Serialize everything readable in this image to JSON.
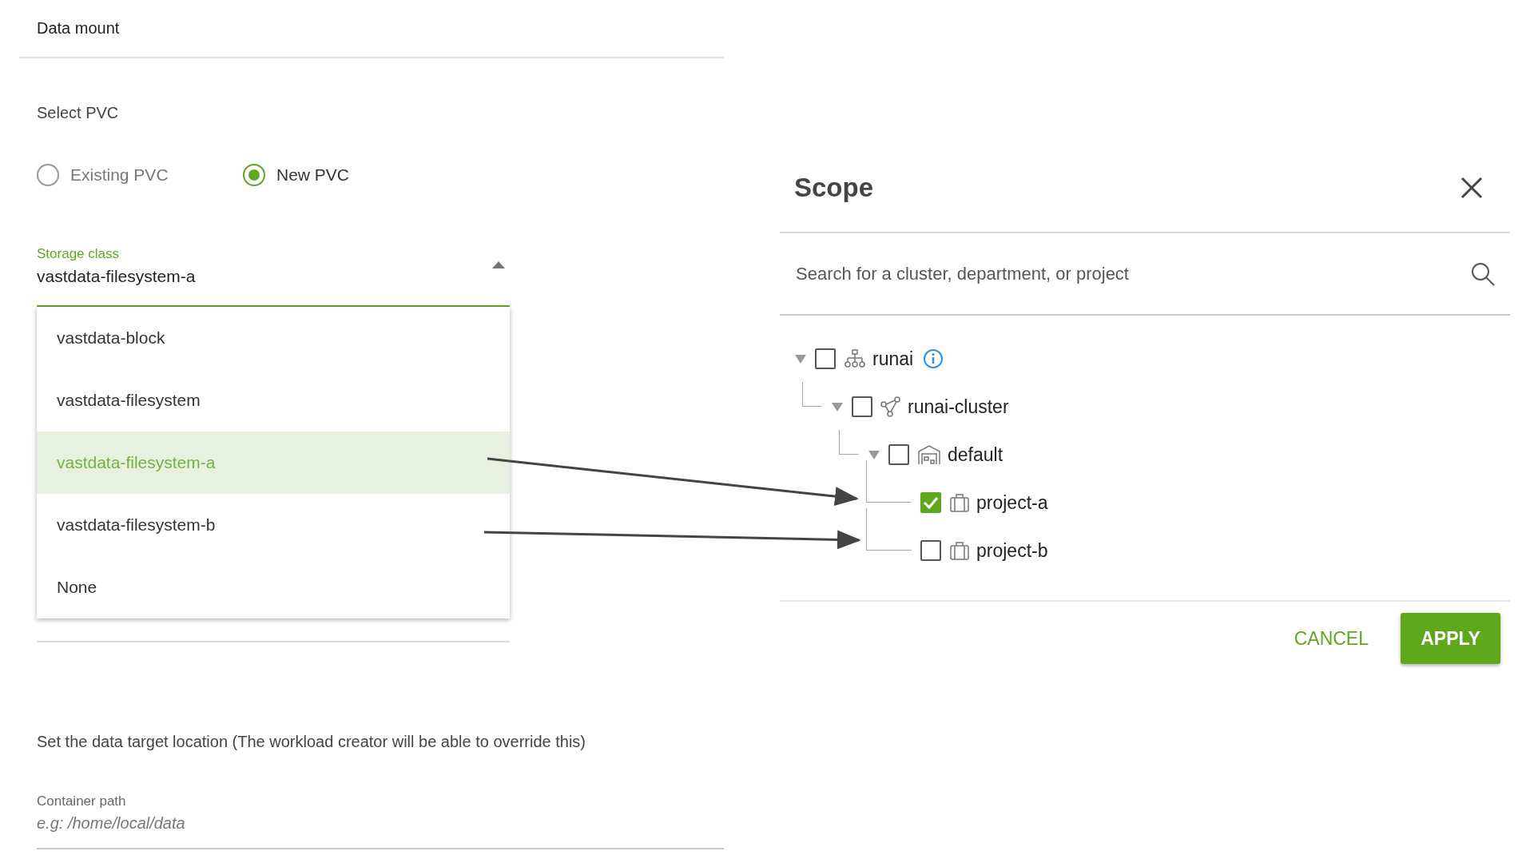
{
  "form": {
    "title": "Data mount",
    "pvc_label": "Select PVC",
    "pvc_options": [
      {
        "label": "Existing PVC",
        "selected": false
      },
      {
        "label": "New PVC",
        "selected": true
      }
    ],
    "storage_class": {
      "label": "Storage class",
      "value": "vastdata-filesystem-a",
      "expanded": true,
      "options": [
        {
          "label": "vastdata-block",
          "selected": false
        },
        {
          "label": "vastdata-filesystem",
          "selected": false
        },
        {
          "label": "vastdata-filesystem-a",
          "selected": true
        },
        {
          "label": "vastdata-filesystem-b",
          "selected": false
        },
        {
          "label": "None",
          "selected": false
        }
      ]
    },
    "target_text": "Set the data target location (The workload creator will be able to override this)",
    "container_path": {
      "label": "Container path",
      "placeholder": "e.g: /home/local/data"
    }
  },
  "scope_dialog": {
    "title": "Scope",
    "search": {
      "placeholder": "Search for a cluster, department, or project"
    },
    "tree": [
      {
        "label": "runai",
        "kind": "org",
        "checked": false,
        "expanded": true,
        "children": [
          {
            "label": "runai-cluster",
            "kind": "cluster",
            "checked": false,
            "expanded": true,
            "children": [
              {
                "label": "default",
                "kind": "department",
                "checked": false,
                "expanded": true,
                "children": [
                  {
                    "label": "project-a",
                    "kind": "project",
                    "checked": true
                  },
                  {
                    "label": "project-b",
                    "kind": "project",
                    "checked": false
                  }
                ]
              }
            ]
          }
        ]
      }
    ],
    "buttons": {
      "cancel": "CANCEL",
      "apply": "APPLY"
    }
  }
}
